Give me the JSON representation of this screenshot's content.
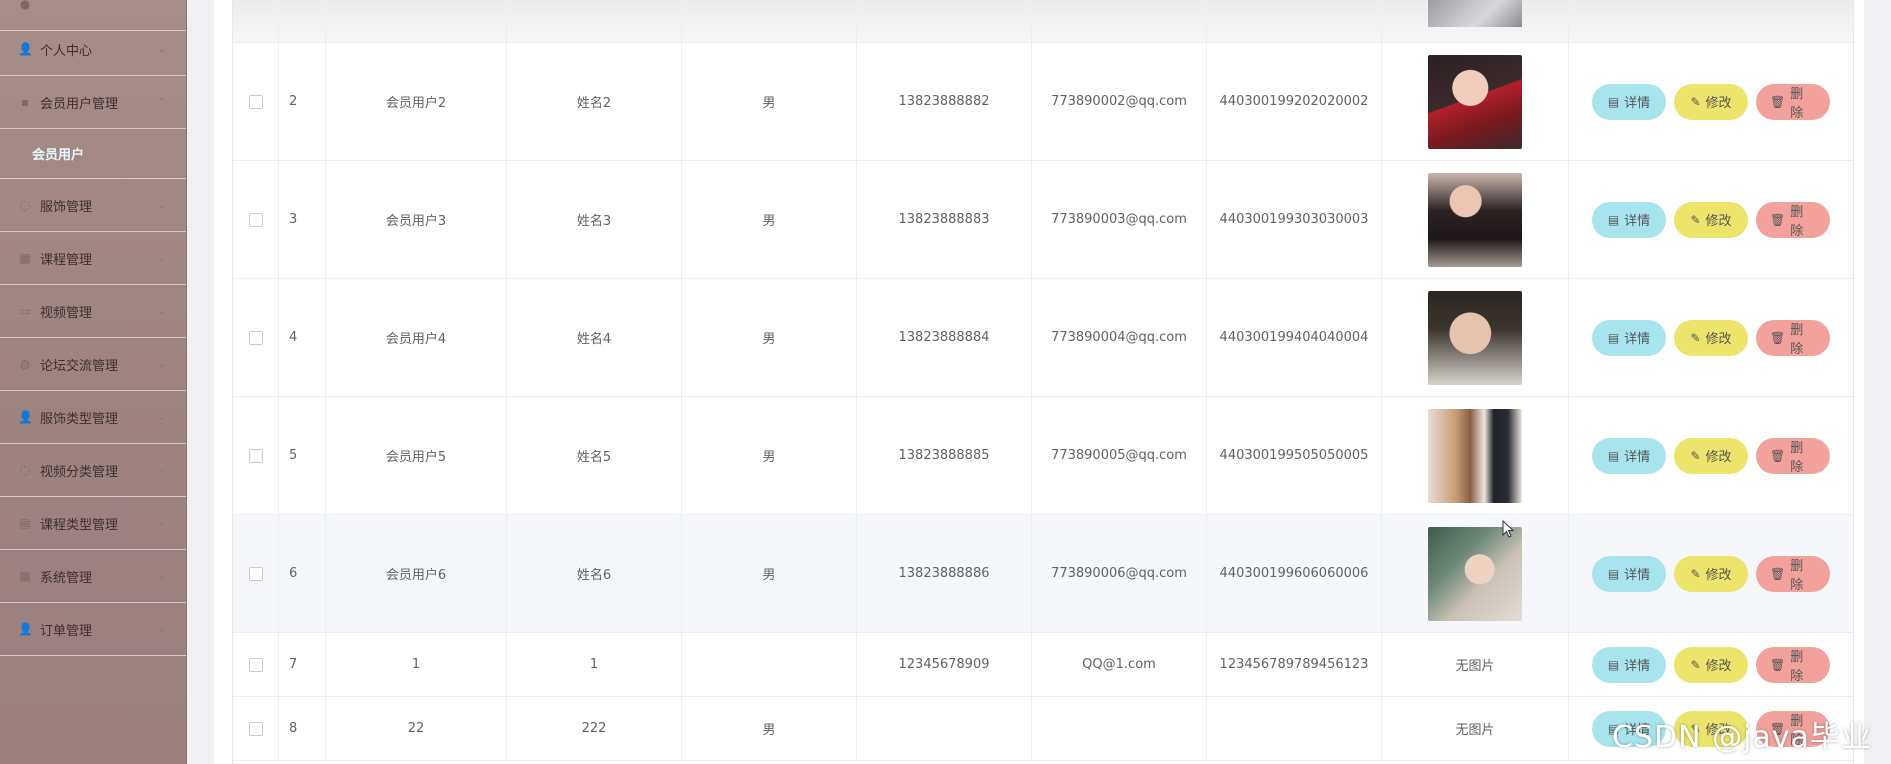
{
  "sidebar": {
    "items": [
      {
        "label": "个人中心",
        "icon": "user-icon"
      },
      {
        "label": "会员用户管理",
        "icon": "users-icon"
      },
      {
        "label": "服饰管理",
        "icon": "shirt-icon"
      },
      {
        "label": "课程管理",
        "icon": "book-icon"
      },
      {
        "label": "视频管理",
        "icon": "video-icon"
      },
      {
        "label": "论坛交流管理",
        "icon": "forum-icon"
      },
      {
        "label": "服饰类型管理",
        "icon": "tag-icon"
      },
      {
        "label": "视频分类管理",
        "icon": "folder-icon"
      },
      {
        "label": "课程类型管理",
        "icon": "list-icon"
      },
      {
        "label": "系统管理",
        "icon": "gear-icon"
      },
      {
        "label": "订单管理",
        "icon": "order-icon"
      }
    ],
    "active_sub": "会员用户"
  },
  "buttons": {
    "detail": "详情",
    "edit": "修改",
    "delete": "删除"
  },
  "no_image_text": "无图片",
  "rows": [
    {
      "index": "2",
      "account": "会员用户2",
      "name": "姓名2",
      "gender": "男",
      "phone": "13823888882",
      "email": "773890002@qq.com",
      "idcard": "440300199202020002",
      "photo": "photo-a"
    },
    {
      "index": "3",
      "account": "会员用户3",
      "name": "姓名3",
      "gender": "男",
      "phone": "13823888883",
      "email": "773890003@qq.com",
      "idcard": "440300199303030003",
      "photo": "photo-b"
    },
    {
      "index": "4",
      "account": "会员用户4",
      "name": "姓名4",
      "gender": "男",
      "phone": "13823888884",
      "email": "773890004@qq.com",
      "idcard": "440300199404040004",
      "photo": "photo-c"
    },
    {
      "index": "5",
      "account": "会员用户5",
      "name": "姓名5",
      "gender": "男",
      "phone": "13823888885",
      "email": "773890005@qq.com",
      "idcard": "440300199505050005",
      "photo": "photo-d"
    },
    {
      "index": "6",
      "account": "会员用户6",
      "name": "姓名6",
      "gender": "男",
      "phone": "13823888886",
      "email": "773890006@qq.com",
      "idcard": "440300199606060006",
      "photo": "photo-e"
    },
    {
      "index": "7",
      "account": "1",
      "name": "1",
      "gender": "",
      "phone": "12345678909",
      "email": "QQ@1.com",
      "idcard": "123456789789456123",
      "photo": ""
    },
    {
      "index": "8",
      "account": "22",
      "name": "222",
      "gender": "男",
      "phone": "",
      "email": "",
      "idcard": "",
      "photo": ""
    }
  ],
  "watermark": "CSDN @java毕业"
}
